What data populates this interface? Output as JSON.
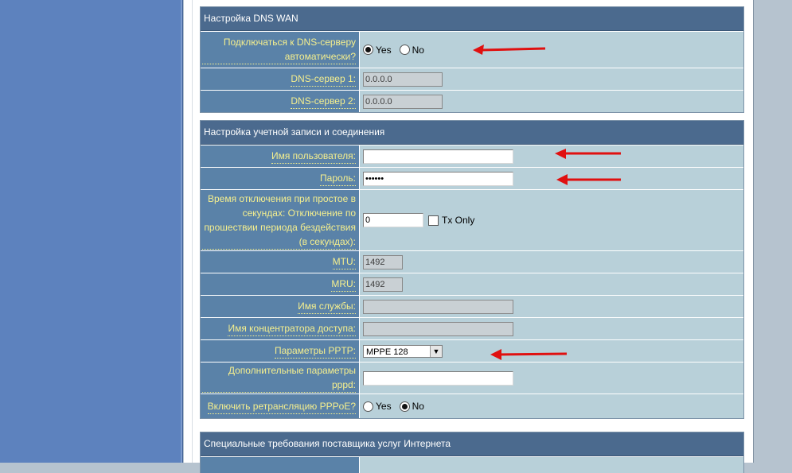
{
  "sections": {
    "dns": {
      "title": "Настройка DNS WAN",
      "auto_dns_label": "Подключаться к DNS-серверу автоматически?",
      "auto_yes": "Yes",
      "auto_no": "No",
      "dns1_label": "DNS-сервер 1:",
      "dns1_value": "0.0.0.0",
      "dns2_label": "DNS-сервер 2:",
      "dns2_value": "0.0.0.0"
    },
    "account": {
      "title": "Настройка учетной записи и соединения",
      "username_label": "Имя пользователя:",
      "username_value": "",
      "password_label": "Пароль:",
      "password_value": "••••••",
      "idle_label": "Время отключения при простое в секундах: Отключение по прошествии периода бездействия (в секундах):",
      "idle_value": "0",
      "tx_only": "Tx Only",
      "mtu_label": "MTU:",
      "mtu_value": "1492",
      "mru_label": "MRU:",
      "mru_value": "1492",
      "service_label": "Имя службы:",
      "service_value": "",
      "ac_label": "Имя концентратора доступа:",
      "ac_value": "",
      "pptp_label": "Параметры PPTP:",
      "pptp_value": "MPPE 128",
      "pppd_label": "Дополнительные параметры pppd:",
      "pppd_value": "",
      "relay_label": "Включить ретрансляцию PPPoE?",
      "relay_yes": "Yes",
      "relay_no": "No"
    },
    "isp": {
      "title": "Специальные требования поставщика услуг Интернета"
    }
  },
  "colors": {
    "section_header": "#4b6a8e",
    "label_bg": "#5a82a8",
    "label_text": "#f5ef8e",
    "value_bg": "#b8d0d9",
    "annotation_arrow": "#e01010"
  }
}
